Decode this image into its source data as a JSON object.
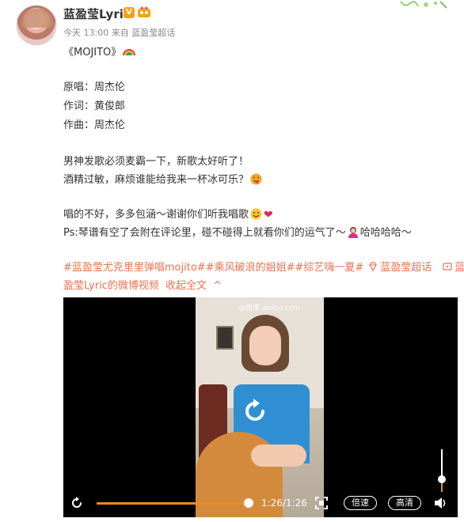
{
  "post": {
    "username": "蓝盈莹Lyric",
    "verified_badge": "V",
    "time": "今天 13:00",
    "source_prefix": "来自",
    "source": "蓝盈莹超话"
  },
  "content": {
    "title": "《MOJITO》",
    "credits": [
      "原唱：周杰伦",
      "作词：黄俊郎",
      "作曲：周杰伦"
    ],
    "para1_line1": "男神发歌必须麦霸一下，新歌太好听了！",
    "para1_line2": "酒精过敏，麻烦谁能给我来一杯冰可乐？",
    "para2_line1": "唱的不好，多多包涵～谢谢你们听我唱歌",
    "para2_line2_a": "Ps:琴谱有空了会附在评论里，碰不碰得上就看你们的运气了～",
    "para2_line2_b": "哈哈哈哈～",
    "topics_line1": {
      "tag1": "#蓝盈莹尤克里里弹唱mojito#",
      "tag2": "#乘风破浪的姐姐#",
      "tag3": "#综艺嗨一夏#",
      "supertopic": "蓝盈莹超话",
      "video_link_prefix": "蓝"
    },
    "topics_line2": {
      "video_link_rest": "盈莹Lyric的微博视频",
      "collapse": "收起全文",
      "collapse_arrow": "^"
    }
  },
  "video": {
    "watermark": "@微博 weibo.com",
    "time": "1:26/1:26",
    "progress": 1.0,
    "volume": 0.3,
    "speed_label": "倍速",
    "quality_label": "高清"
  },
  "icons": {
    "rainbow": "rainbow-emoji",
    "replay": "replay-icon",
    "fullscreen": "fullscreen-icon",
    "volume": "volume-icon",
    "supertopic": "diamond-icon",
    "video_link": "video-icon"
  },
  "colors": {
    "link": "#eb7350",
    "progress": "#f08a24",
    "vip": "#f7a219"
  }
}
